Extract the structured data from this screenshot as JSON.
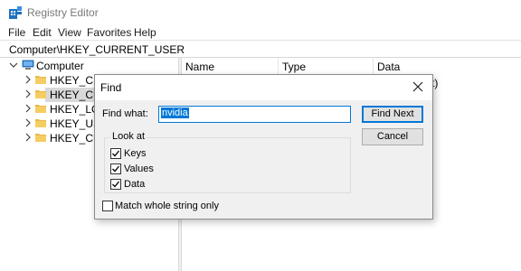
{
  "window": {
    "title": "Registry Editor",
    "icon": "registry-editor-icon"
  },
  "menu": {
    "items": [
      "File",
      "Edit",
      "View",
      "Favorites",
      "Help"
    ]
  },
  "address": {
    "path": "Computer\\HKEY_CURRENT_USER"
  },
  "tree": {
    "root": "Computer",
    "items": [
      {
        "label": "HKEY_CLA",
        "selected": false
      },
      {
        "label": "HKEY_CUR",
        "selected": true
      },
      {
        "label": "HKEY_LOC",
        "selected": false
      },
      {
        "label": "HKEY_USE",
        "selected": false
      },
      {
        "label": "HKEY_CUR",
        "selected": false
      }
    ]
  },
  "list": {
    "columns": [
      "Name",
      "Type",
      "Data"
    ],
    "partial_row_data": "t)"
  },
  "find_dialog": {
    "title": "Find",
    "find_what_label": "Find what:",
    "find_what_value": "nvidia",
    "find_next_label": "Find Next",
    "cancel_label": "Cancel",
    "look_at_label": "Look at",
    "options": [
      {
        "label": "Keys",
        "checked": true
      },
      {
        "label": "Values",
        "checked": true
      },
      {
        "label": "Data",
        "checked": true
      }
    ],
    "match_whole_label": "Match whole string only",
    "match_whole_checked": false
  },
  "colors": {
    "accent": "#0078d7",
    "folder": "#e8b84a",
    "dialog_bg": "#f0f0f0",
    "selection": "#d9d9d9"
  }
}
